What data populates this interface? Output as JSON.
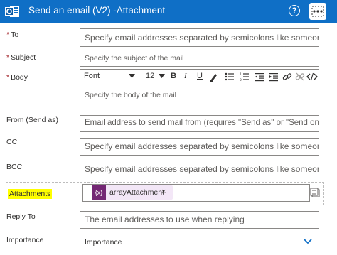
{
  "header": {
    "title": "Send an email (V2) -Attachment",
    "help_glyph": "?",
    "app_icon": "outlook-icon",
    "menu_icon": "more-options-icon",
    "bg_color": "#0f6fc6"
  },
  "fields": {
    "to": {
      "label": "To",
      "placeholder": "Specify email addresses separated by semicolons like someone@con"
    },
    "subject": {
      "label": "Subject",
      "placeholder": "Specify the subject of the mail"
    },
    "body": {
      "label": "Body",
      "placeholder": "Specify the body of the mail"
    },
    "from": {
      "label": "From (Send as)",
      "placeholder": "Email address to send mail from (requires \"Send as\" or \"Send on beha"
    },
    "cc": {
      "label": "CC",
      "placeholder": "Specify email addresses separated by semicolons like someone@con"
    },
    "bcc": {
      "label": "BCC",
      "placeholder": "Specify email addresses separated by semicolons like someone@con"
    },
    "attachments": {
      "label": "Attachments",
      "token_glyph": "{x}",
      "token_text": "arrayAttachment",
      "token_remove": "×",
      "highlight_color": "#ffff00"
    },
    "reply_to": {
      "label": "Reply To",
      "placeholder": "The email addresses to use when replying"
    },
    "importance": {
      "label": "Importance",
      "value": "Importance"
    }
  },
  "toolbar": {
    "font": "Font",
    "size": "12",
    "bold": "B",
    "italic": "I",
    "underline": "U"
  },
  "required_marker": "*"
}
